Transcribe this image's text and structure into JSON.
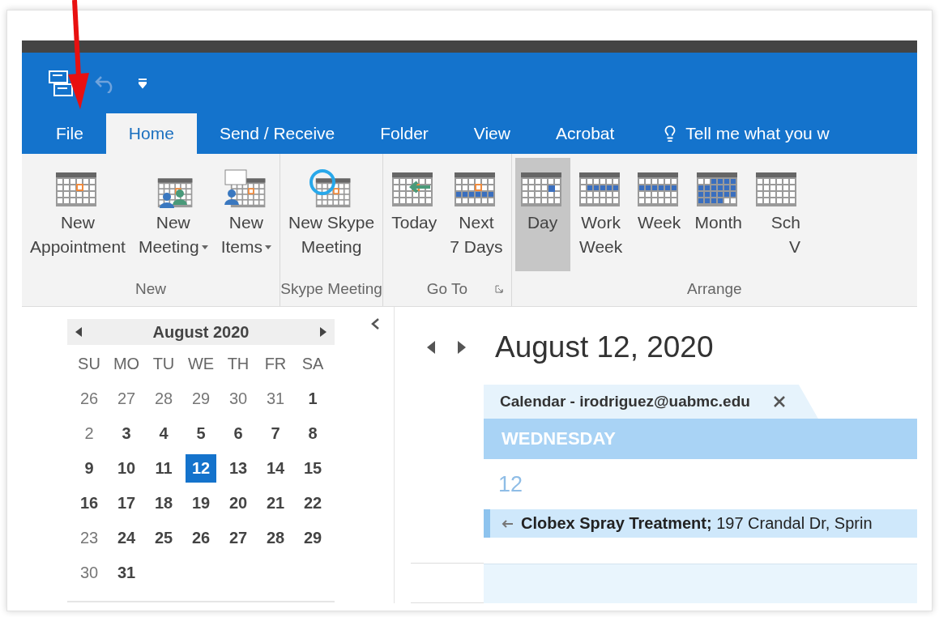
{
  "tabs": [
    {
      "label": "File",
      "selected": false
    },
    {
      "label": "Home",
      "selected": true
    },
    {
      "label": "Send / Receive",
      "selected": false
    },
    {
      "label": "Folder",
      "selected": false
    },
    {
      "label": "View",
      "selected": false
    },
    {
      "label": "Acrobat",
      "selected": false
    }
  ],
  "tell_me": {
    "text": "Tell me what you w"
  },
  "ribbon": {
    "groups": [
      {
        "label": "New",
        "launcher": false,
        "buttons": [
          {
            "lines": [
              "New",
              "Appointment"
            ],
            "kind": "appointment",
            "dropdown": false,
            "selected": false
          },
          {
            "lines": [
              "New",
              "Meeting"
            ],
            "kind": "meeting",
            "dropdown": true,
            "selected": false
          },
          {
            "lines": [
              "New",
              "Items"
            ],
            "kind": "items",
            "dropdown": true,
            "selected": false
          }
        ]
      },
      {
        "label": "Skype Meeting",
        "launcher": false,
        "buttons": [
          {
            "lines": [
              "New Skype",
              "Meeting"
            ],
            "kind": "skype",
            "dropdown": false,
            "selected": false
          }
        ]
      },
      {
        "label": "Go To",
        "launcher": true,
        "buttons": [
          {
            "lines": [
              "Today"
            ],
            "kind": "today",
            "dropdown": false,
            "selected": false
          },
          {
            "lines": [
              "Next",
              "7 Days"
            ],
            "kind": "next7",
            "dropdown": false,
            "selected": false
          }
        ]
      },
      {
        "label": "Arrange",
        "launcher": false,
        "buttons": [
          {
            "lines": [
              "Day"
            ],
            "kind": "day",
            "dropdown": false,
            "selected": true
          },
          {
            "lines": [
              "Work",
              "Week"
            ],
            "kind": "workweek",
            "dropdown": false,
            "selected": false
          },
          {
            "lines": [
              "Week"
            ],
            "kind": "week",
            "dropdown": false,
            "selected": false
          },
          {
            "lines": [
              "Month"
            ],
            "kind": "month",
            "dropdown": false,
            "selected": false
          },
          {
            "lines": [
              "Sch",
              "V"
            ],
            "kind": "schedule",
            "dropdown": false,
            "selected": false
          }
        ]
      }
    ]
  },
  "mini_calendar": {
    "title": "August 2020",
    "weekdays": [
      "SU",
      "MO",
      "TU",
      "WE",
      "TH",
      "FR",
      "SA"
    ],
    "weeks": [
      [
        {
          "day": "26",
          "bold": false,
          "selected": false
        },
        {
          "day": "27",
          "bold": false,
          "selected": false
        },
        {
          "day": "28",
          "bold": false,
          "selected": false
        },
        {
          "day": "29",
          "bold": false,
          "selected": false
        },
        {
          "day": "30",
          "bold": false,
          "selected": false
        },
        {
          "day": "31",
          "bold": false,
          "selected": false
        },
        {
          "day": "1",
          "bold": true,
          "selected": false
        }
      ],
      [
        {
          "day": "2",
          "bold": false,
          "selected": false
        },
        {
          "day": "3",
          "bold": true,
          "selected": false
        },
        {
          "day": "4",
          "bold": true,
          "selected": false
        },
        {
          "day": "5",
          "bold": true,
          "selected": false
        },
        {
          "day": "6",
          "bold": true,
          "selected": false
        },
        {
          "day": "7",
          "bold": true,
          "selected": false
        },
        {
          "day": "8",
          "bold": true,
          "selected": false
        }
      ],
      [
        {
          "day": "9",
          "bold": true,
          "selected": false
        },
        {
          "day": "10",
          "bold": true,
          "selected": false
        },
        {
          "day": "11",
          "bold": true,
          "selected": false
        },
        {
          "day": "12",
          "bold": true,
          "selected": true
        },
        {
          "day": "13",
          "bold": true,
          "selected": false
        },
        {
          "day": "14",
          "bold": true,
          "selected": false
        },
        {
          "day": "15",
          "bold": true,
          "selected": false
        }
      ],
      [
        {
          "day": "16",
          "bold": true,
          "selected": false
        },
        {
          "day": "17",
          "bold": true,
          "selected": false
        },
        {
          "day": "18",
          "bold": true,
          "selected": false
        },
        {
          "day": "19",
          "bold": true,
          "selected": false
        },
        {
          "day": "20",
          "bold": true,
          "selected": false
        },
        {
          "day": "21",
          "bold": true,
          "selected": false
        },
        {
          "day": "22",
          "bold": true,
          "selected": false
        }
      ],
      [
        {
          "day": "23",
          "bold": false,
          "selected": false
        },
        {
          "day": "24",
          "bold": true,
          "selected": false
        },
        {
          "day": "25",
          "bold": true,
          "selected": false
        },
        {
          "day": "26",
          "bold": true,
          "selected": false
        },
        {
          "day": "27",
          "bold": true,
          "selected": false
        },
        {
          "day": "28",
          "bold": true,
          "selected": false
        },
        {
          "day": "29",
          "bold": true,
          "selected": false
        }
      ],
      [
        {
          "day": "30",
          "bold": false,
          "selected": false
        },
        {
          "day": "31",
          "bold": true,
          "selected": false
        }
      ]
    ]
  },
  "day_view": {
    "date": "August 12, 2020",
    "calendar_tab": "Calendar - irodriguez@uabmc.edu",
    "weekday": "WEDNESDAY",
    "day_number": "12",
    "events": [
      {
        "title": "Clobex Spray Treatment;",
        "location": "197 Crandal Dr, Sprin"
      }
    ]
  }
}
